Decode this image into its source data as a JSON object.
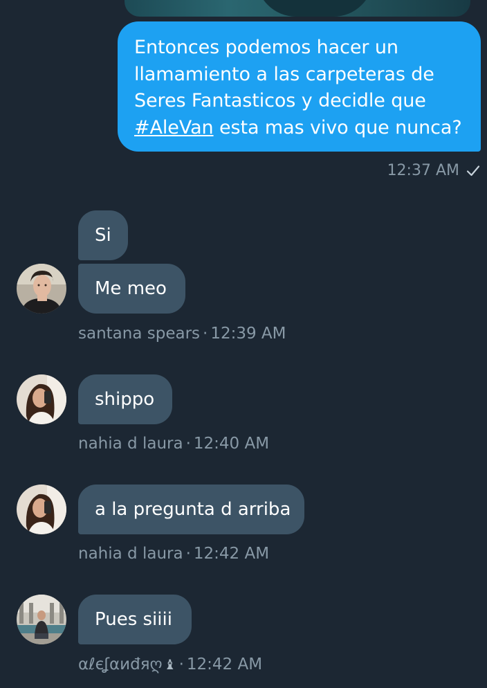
{
  "colors": {
    "background": "#1c2733",
    "sent_bubble": "#1da1f2",
    "received_bubble": "#3d5466",
    "meta_text": "#8899a6"
  },
  "sent": {
    "lines": [
      "Entonces podemos hacer un",
      "llamamiento a las carpeteras de",
      "Seres Fantasticos y decidle que"
    ],
    "last_line_hashtag": "#AleVan",
    "last_line_rest": " esta mas vivo que nunca?",
    "time": "12:37 AM",
    "status_icon": "check-icon"
  },
  "groups": [
    {
      "messages": [
        "Si",
        "Me meo"
      ],
      "sender": "santana spears",
      "time": "12:39 AM",
      "avatar": "avatar-santana"
    },
    {
      "messages": [
        "shippo"
      ],
      "sender": "nahia d laura",
      "time": "12:40 AM",
      "avatar": "avatar-nahia"
    },
    {
      "messages": [
        "a la pregunta d arriba"
      ],
      "sender": "nahia d laura",
      "time": "12:42 AM",
      "avatar": "avatar-nahia"
    },
    {
      "messages": [
        "Pues siiii"
      ],
      "sender": "αℓєʆαиđяღ",
      "sender_icon": "♝",
      "time": "12:42 AM",
      "avatar": "avatar-alejandro"
    }
  ],
  "separator": "·"
}
